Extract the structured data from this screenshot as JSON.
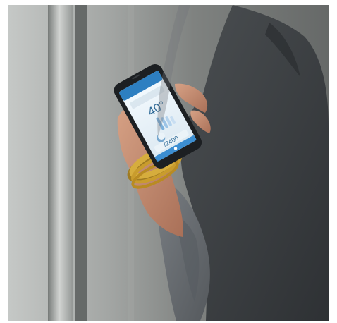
{
  "scene": {
    "colors": {
      "background_left": "#b7b9b8",
      "background_mid": "#8f918f",
      "jacket": "#55585b",
      "jacket_dark": "#3f4245",
      "sleeve": "#6c7074",
      "skin": "#c89278",
      "skin_shadow": "#9e6b57",
      "phone_body": "#1c1f22",
      "phone_screen": "#e8f1f7",
      "app_header": "#2d7fc1",
      "app_accent": "#3c8ed1",
      "bracelet": "#d6ad3d",
      "bracelet_shadow": "#9f7b22"
    },
    "icons": {
      "thermostat": "thermostat-icon",
      "moon": "moon-icon",
      "app_status": "app-status-icon"
    }
  },
  "phone_screen": {
    "temperature": "40°",
    "secondary_reading": "/2400"
  }
}
